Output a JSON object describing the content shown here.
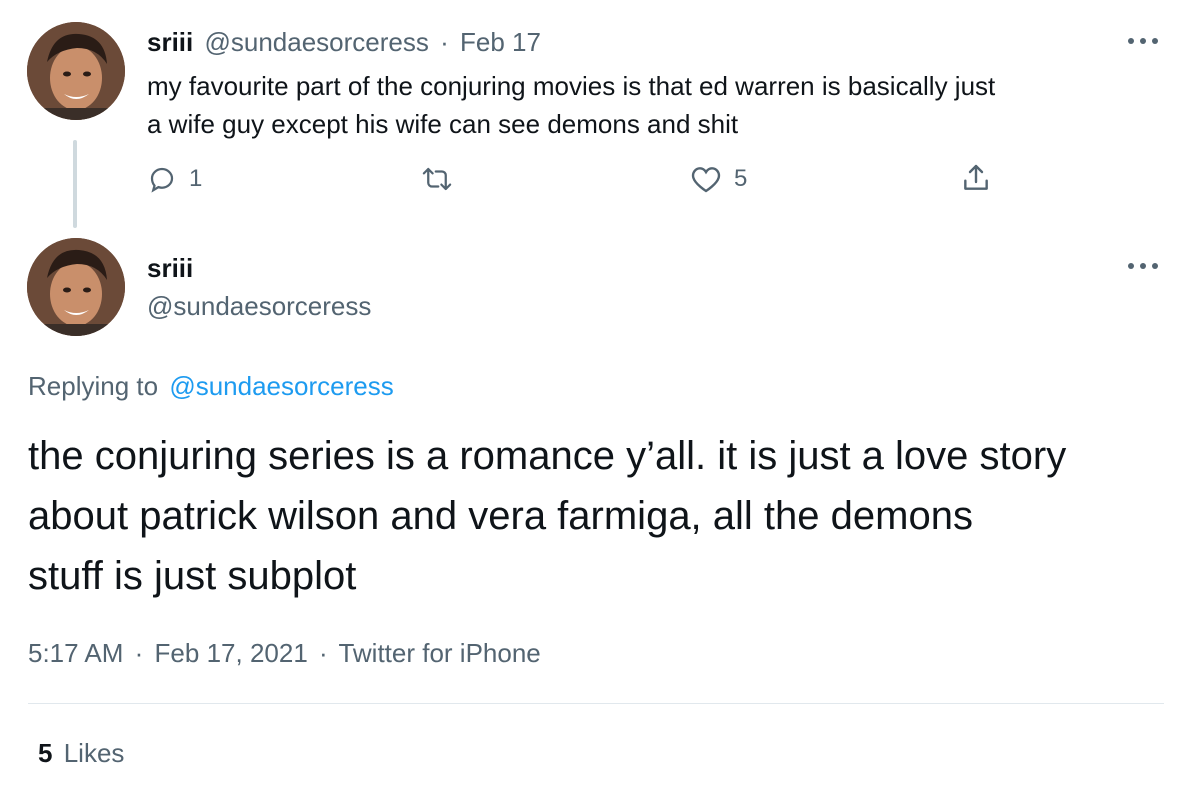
{
  "colors": {
    "text": "#0f1419",
    "muted": "#536471",
    "link": "#1d9bf0",
    "divider": "#e1e8ed"
  },
  "parent_tweet": {
    "display_name": "sriii",
    "handle": "@sundaesorceress",
    "separator": "·",
    "date": "Feb 17",
    "text_line1": "my favourite part of the conjuring movies is that ed warren is basically just",
    "text_line2": "a wife guy except his wife can see demons and shit",
    "reply_count": "1",
    "retweet_count": "",
    "like_count": "5",
    "icons": [
      "reply-icon",
      "retweet-icon",
      "like-icon",
      "share-icon",
      "more-icon"
    ]
  },
  "main_tweet": {
    "display_name": "sriii",
    "handle": "@sundaesorceress",
    "replying_to_label": "Replying to",
    "replying_to_handle": "@sundaesorceress",
    "text_line1": "the conjuring series is a romance y’all. it is just a love story",
    "text_line2": "about patrick wilson and vera farmiga, all the demons",
    "text_line3": "stuff is just subplot",
    "time": "5:17 AM",
    "separator": "·",
    "date": "Feb 17, 2021",
    "source": "Twitter for iPhone",
    "likes_count": "5",
    "likes_label": "Likes"
  }
}
